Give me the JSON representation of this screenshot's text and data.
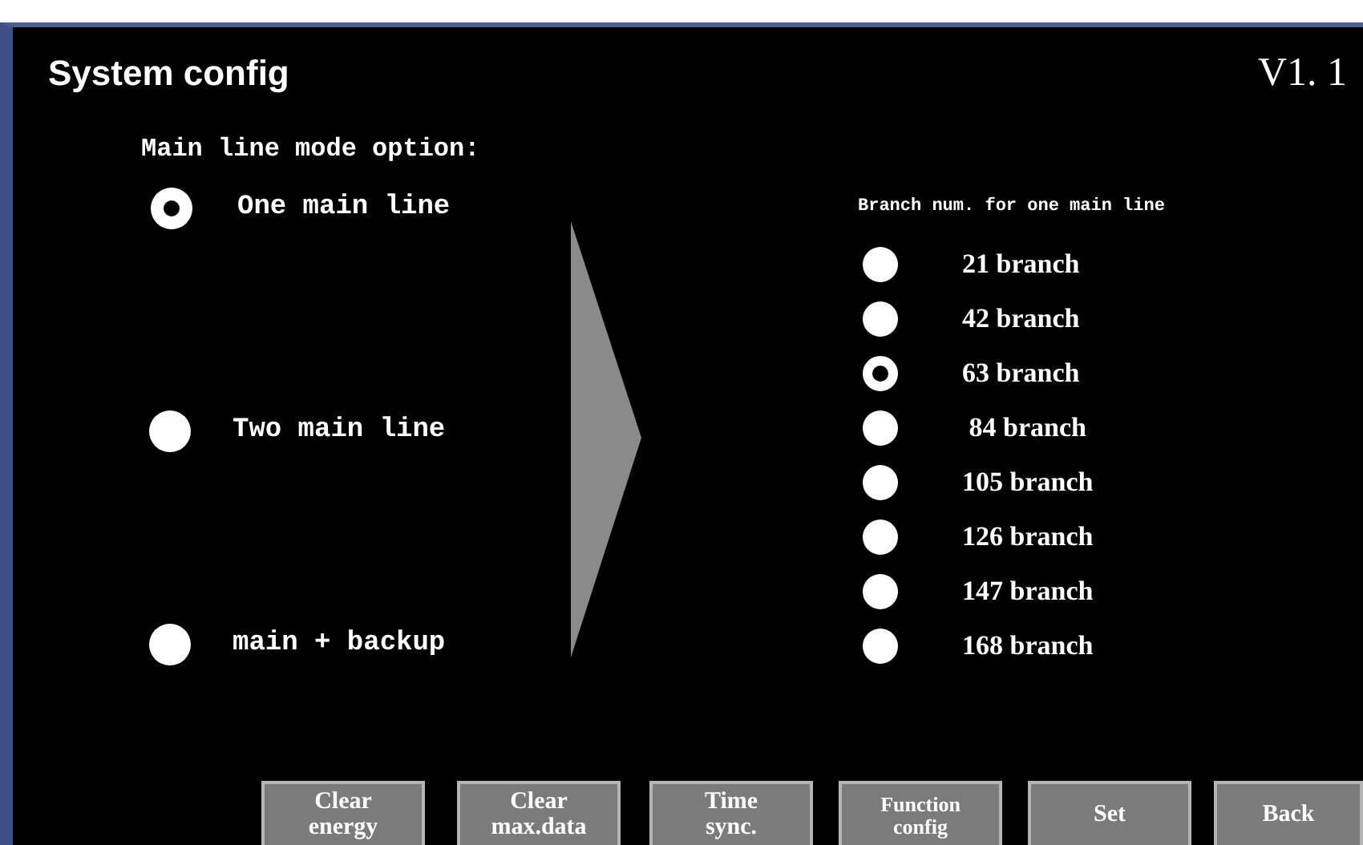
{
  "title": "System config",
  "version": "V1. 1",
  "mode_group": {
    "label": "Main line mode option:",
    "options": [
      {
        "label": "One main line",
        "selected": true
      },
      {
        "label": "Two main line",
        "selected": false
      },
      {
        "label": "main + backup",
        "selected": false
      }
    ]
  },
  "branch_group": {
    "label": "Branch num. for one main line",
    "options": [
      {
        "label": "21 branch",
        "selected": false
      },
      {
        "label": "42 branch",
        "selected": false
      },
      {
        "label": "63 branch",
        "selected": true
      },
      {
        "label": " 84 branch",
        "selected": false
      },
      {
        "label": "105 branch",
        "selected": false
      },
      {
        "label": "126 branch",
        "selected": false
      },
      {
        "label": "147 branch",
        "selected": false
      },
      {
        "label": "168 branch",
        "selected": false
      }
    ]
  },
  "buttons": [
    {
      "lines": [
        "Clear",
        "energy"
      ]
    },
    {
      "lines": [
        "Clear",
        "max.data"
      ]
    },
    {
      "lines": [
        "Time",
        "sync."
      ]
    },
    {
      "lines": [
        "Function",
        "config"
      ],
      "small": true
    },
    {
      "lines": [
        "Set"
      ]
    },
    {
      "lines": [
        "Back"
      ]
    }
  ]
}
